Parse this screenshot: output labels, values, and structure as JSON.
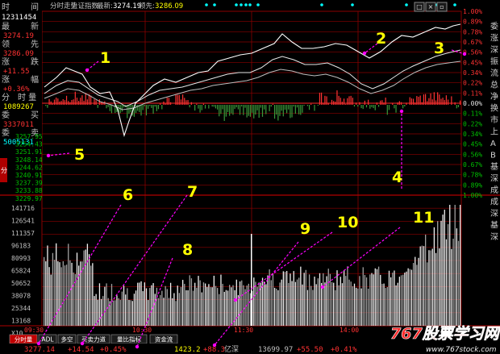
{
  "header": {
    "chart_name": "分时走势",
    "index_name": "上证指数",
    "latest_label": "最新:",
    "latest_value": "3274.19",
    "lead_label": "领先:",
    "lead_value": "3286.09"
  },
  "window_buttons": [
    "□",
    "×",
    "▫"
  ],
  "left_panel": {
    "time_label": "时",
    "time_label_b": "间",
    "volume_top": "12311454",
    "latest_label": "最",
    "latest_label_b": "新",
    "latest_value": "3274.19",
    "lead_label": "领",
    "lead_label_b": "先",
    "lead_value": "3286.09",
    "change_label": "涨",
    "change_label_b": "跌",
    "change_value": "+11.55",
    "pct_label": "涨",
    "pct_label_b": "幅",
    "pct_value": "+0.36%",
    "vol_label": "分",
    "vol_label_b": "时 量",
    "vol_value": "1089267",
    "buy_label": "委",
    "buy_label_b": "买",
    "buy_value": "3337011",
    "sell_label": "委",
    "sell_label_b": "卖",
    "sell_value": "5005131",
    "side_tab": "分"
  },
  "price_axis_left": [
    "3257.95",
    "3254.43",
    "3251.91",
    "3248.14",
    "3244.62",
    "3240.91",
    "3237.39",
    "3233.88",
    "3229.97"
  ],
  "vol_axis_left": [
    "141716",
    "126541",
    "111357",
    "96183",
    "80993",
    "65824",
    "50652",
    "38078",
    "25344",
    "13168",
    "X10"
  ],
  "pct_axis_right": [
    "1.00%",
    "0.89%",
    "0.78%",
    "0.67%",
    "0.56%",
    "0.45%",
    "0.34%",
    "0.22%",
    "0.11%",
    "0.00%",
    "0.11%",
    "0.22%",
    "0.34%",
    "0.45%",
    "0.56%",
    "0.67%",
    "0.78%",
    "0.89%",
    "1.00%"
  ],
  "right_sidebar": [
    "委",
    "涨",
    "深",
    "振",
    "流",
    "总",
    "净",
    "换",
    "市",
    "上",
    "A",
    "B",
    "基",
    "深",
    "成",
    "成",
    "深",
    "基",
    "深"
  ],
  "time_axis": [
    "09:30",
    "10:30",
    "11:30",
    "14:00"
  ],
  "bottom_tabs": [
    "分时量",
    "ADL",
    "多空",
    "买卖力道",
    "量比指标",
    "资金流"
  ],
  "status_bar": {
    "price": "3277.14",
    "change": "+14.54",
    "pct": "+0.45%",
    "amount": "1423.2",
    "amount_change": "+88.3",
    "amount_unit": "亿深",
    "sz_price": "13699.97",
    "sz_change": "+55.50",
    "sz_pct": "+0.41%"
  },
  "annotations": [
    "1",
    "2",
    "3",
    "4",
    "5",
    "6",
    "7",
    "8",
    "9",
    "10",
    "11"
  ],
  "watermark": {
    "text": "767股票学习网",
    "url": "www.767stock.com"
  },
  "colors": {
    "background": "#000000",
    "grid_red": "#8b0000",
    "up_red": "#ff3232",
    "down_green": "#00c000",
    "price_line": "#ffffff",
    "avg_line": "#d0d0d0",
    "annotation_yellow": "#ffff00",
    "arrow_magenta": "#ff00ff",
    "cyan_marker": "#00ffff"
  }
}
